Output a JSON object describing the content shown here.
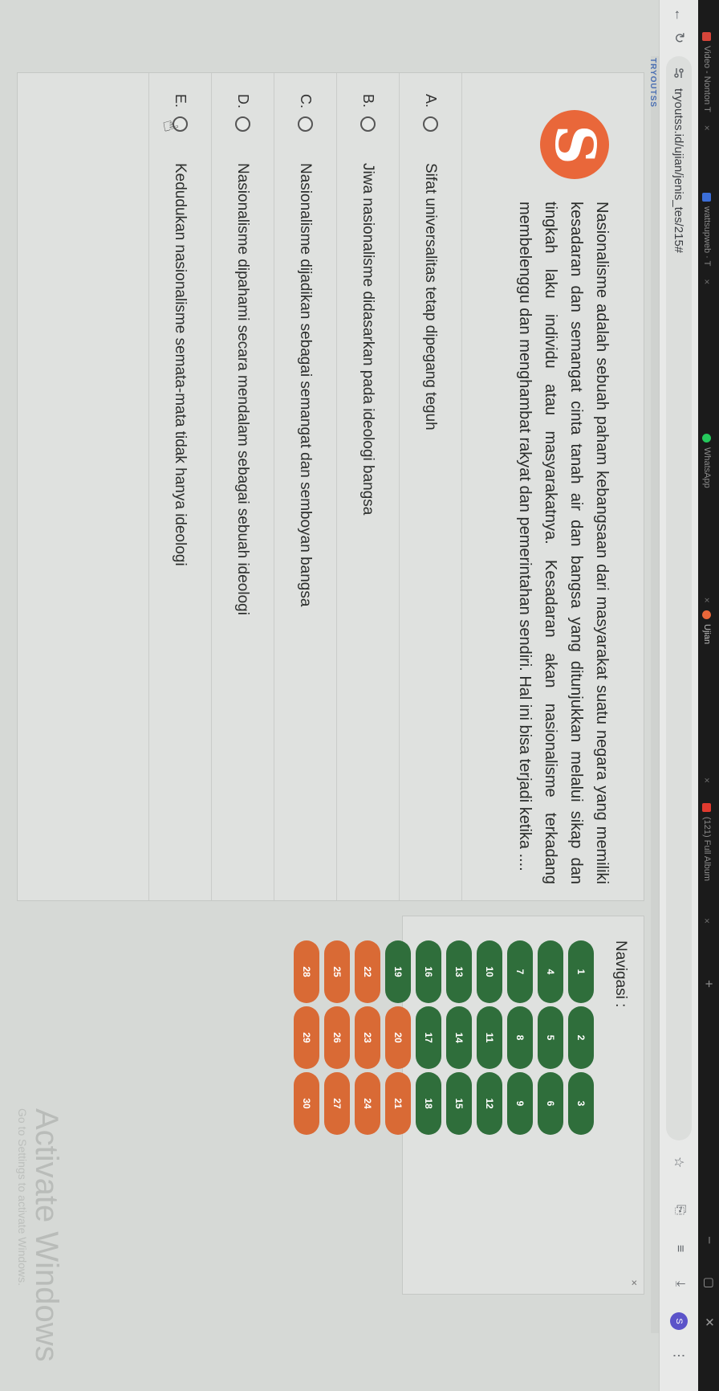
{
  "tabs": [
    {
      "label": "Video - Nonton T",
      "color": "#d6453a"
    },
    {
      "label": "wattsupweb · T",
      "color": "#3b6ed8"
    },
    {
      "label": "WhatsApp",
      "color": "#25c95c"
    },
    {
      "label": "Ujian",
      "color": "#e9673a"
    },
    {
      "label": "(121) Full Album",
      "color": "#e03a2f"
    }
  ],
  "tab_close": "×",
  "new_tab": "+",
  "window": {
    "minimize": "–",
    "maximize": "▢",
    "close": "✕"
  },
  "toolbar": {
    "back_icon": "←",
    "reload_icon": "↻",
    "url": "tryoutss.id/ujian/jenis_tes/215#",
    "star_icon": "☆",
    "ext_icon": "⎘",
    "playlist_icon": "≡",
    "download_icon": "⤓",
    "avatar": "S",
    "menu_icon": "⋮"
  },
  "brand": "TRYOUTSS",
  "logo_letter": "S",
  "question": {
    "text": "Nasionalisme adalah sebuah paham kebangsaan dari masyarakat suatu negara yang memiliki kesadaran dan semangat cinta tanah air dan bangsa yang ditunjukkan melalui sikap dan tingkah laku individu atau masyarakatnya. Kesadaran akan nasionalisme terkadang membelenggu dan menghambat rakyat dan pemerintahan sendiri. Hal ini bisa terjadi ketika ...."
  },
  "options": [
    {
      "letter": "A.",
      "text": "Sifat universalitas tetap dipegang teguh"
    },
    {
      "letter": "B.",
      "text": "Jiwa nasionalisme didasarkan pada ideologi bangsa"
    },
    {
      "letter": "C.",
      "text": "Nasionalisme dijadikan sebagai semangat dan semboyan bangsa"
    },
    {
      "letter": "D.",
      "text": "Nasionalisme dipahami secara mendalam sebagai sebuah ideologi"
    },
    {
      "letter": "E.",
      "text": "Kedudukan nasionalisme semata-mata tidak hanya ideologi"
    }
  ],
  "navigation": {
    "title": "Navigasi :",
    "close": "×",
    "colors": {
      "answered": "#2f6e3b",
      "unanswered": "#d96a35"
    },
    "numbers": [
      {
        "n": "1",
        "answered": true
      },
      {
        "n": "2",
        "answered": true
      },
      {
        "n": "3",
        "answered": true
      },
      {
        "n": "4",
        "answered": true
      },
      {
        "n": "5",
        "answered": true
      },
      {
        "n": "6",
        "answered": true
      },
      {
        "n": "7",
        "answered": true
      },
      {
        "n": "8",
        "answered": true
      },
      {
        "n": "9",
        "answered": true
      },
      {
        "n": "10",
        "answered": true
      },
      {
        "n": "11",
        "answered": true
      },
      {
        "n": "12",
        "answered": true
      },
      {
        "n": "13",
        "answered": true
      },
      {
        "n": "14",
        "answered": true
      },
      {
        "n": "15",
        "answered": true
      },
      {
        "n": "16",
        "answered": true
      },
      {
        "n": "17",
        "answered": true
      },
      {
        "n": "18",
        "answered": true
      },
      {
        "n": "19",
        "answered": true
      },
      {
        "n": "20",
        "answered": false
      },
      {
        "n": "21",
        "answered": false
      },
      {
        "n": "22",
        "answered": false
      },
      {
        "n": "23",
        "answered": false
      },
      {
        "n": "24",
        "answered": false
      },
      {
        "n": "25",
        "answered": false
      },
      {
        "n": "26",
        "answered": false
      },
      {
        "n": "27",
        "answered": false
      },
      {
        "n": "28",
        "answered": false
      },
      {
        "n": "29",
        "answered": false
      },
      {
        "n": "30",
        "answered": false
      }
    ]
  },
  "watermark": {
    "title": "Activate Windows",
    "subtitle": "Go to Settings to activate Windows."
  }
}
